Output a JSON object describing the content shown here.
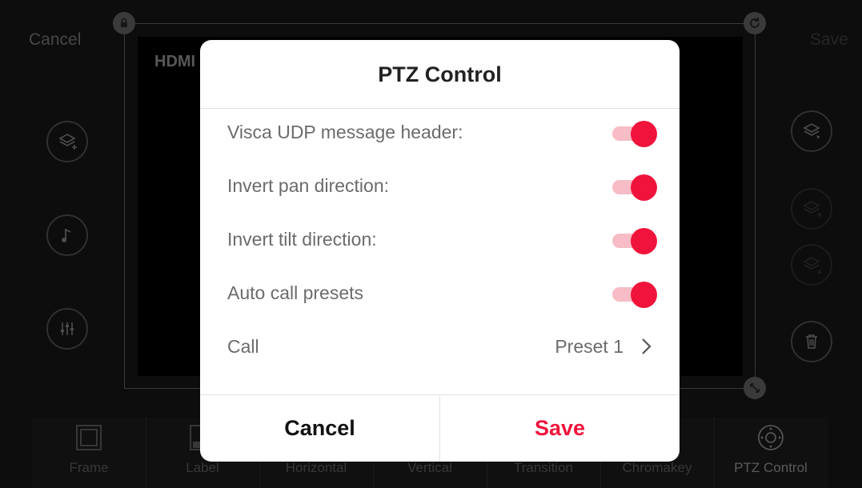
{
  "topbar": {
    "cancel_label": "Cancel",
    "save_label": "Save"
  },
  "canvas": {
    "source_label": "HDMI"
  },
  "toolbar": {
    "items": [
      {
        "label": "Frame",
        "icon": "frame-icon"
      },
      {
        "label": "Label",
        "icon": "label-icon"
      },
      {
        "label": "Horizontal",
        "icon": "horizontal-icon"
      },
      {
        "label": "Vertical",
        "icon": "vertical-icon"
      },
      {
        "label": "Transition",
        "icon": "transition-icon"
      },
      {
        "label": "Chromakey",
        "icon": "chromakey-icon"
      },
      {
        "label": "PTZ Control",
        "icon": "ptz-control-icon"
      }
    ]
  },
  "dialog": {
    "title": "PTZ Control",
    "rows": [
      {
        "label": "Visca UDP message header:",
        "enabled": true
      },
      {
        "label": "Invert pan direction:",
        "enabled": true
      },
      {
        "label": "Invert tilt direction:",
        "enabled": true
      },
      {
        "label": "Auto call presets",
        "enabled": true
      }
    ],
    "call": {
      "label": "Call",
      "value": "Preset 1"
    },
    "cancel_label": "Cancel",
    "save_label": "Save"
  },
  "colors": {
    "accent": "#f0143c",
    "toggle_track": "#f7bcc6",
    "background": "#141414"
  }
}
